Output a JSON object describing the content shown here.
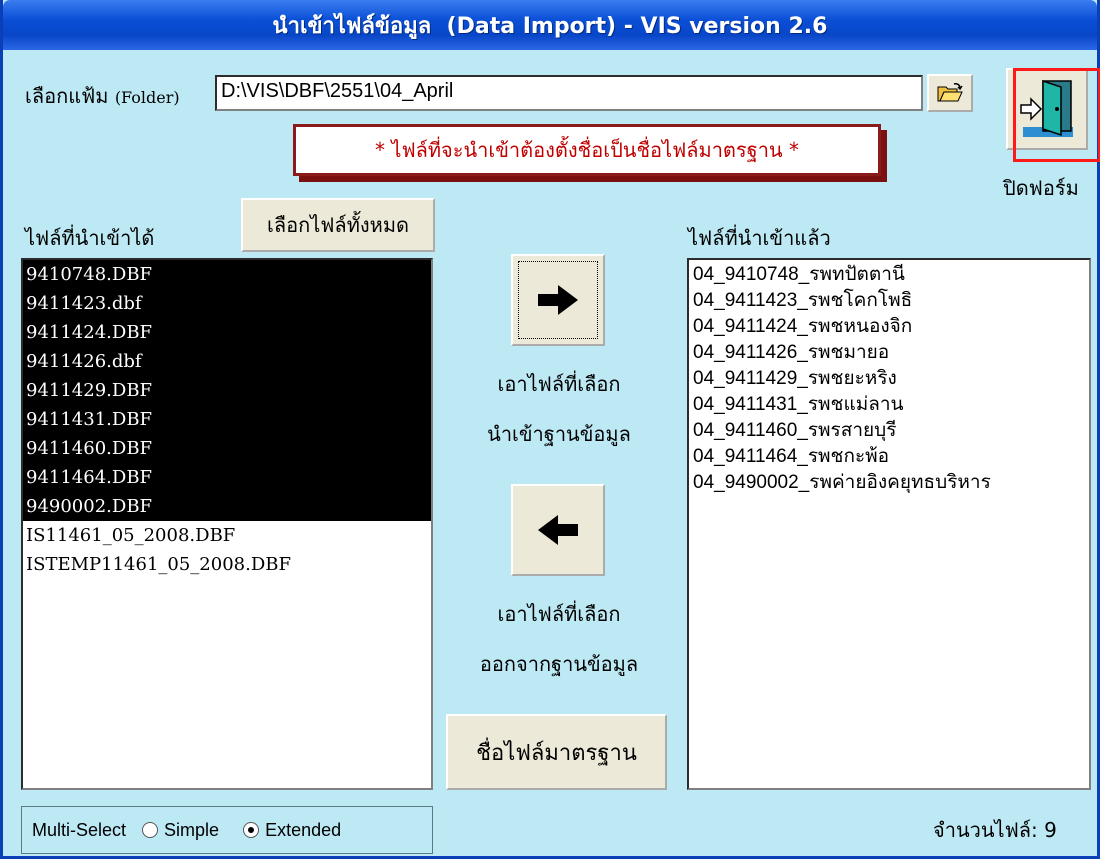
{
  "window": {
    "title": "นำเข้าไฟล์ข้อมูล  (Data Import) - VIS version 2.6"
  },
  "folder": {
    "label": "เลือกแฟ้ม",
    "label_paren": "(Folder)",
    "path": "D:\\VIS\\DBF\\2551\\04_April",
    "browse_icon": "open-folder-icon"
  },
  "close_form": {
    "label": "ปิดฟอร์ม",
    "icon": "exit-door-icon"
  },
  "notice": "* ไฟล์ที่จะนำเข้าต้องตั้งชื่อเป็นชื่อไฟล์มาตรฐาน *",
  "available": {
    "label": "ไฟล์ที่นำเข้าได้",
    "select_all_label": "เลือกไฟล์ทั้งหมด",
    "files": [
      {
        "name": "9410748.DBF",
        "selected": true
      },
      {
        "name": "9411423.dbf",
        "selected": true
      },
      {
        "name": "9411424.DBF",
        "selected": true
      },
      {
        "name": "9411426.dbf",
        "selected": true
      },
      {
        "name": "9411429.DBF",
        "selected": true
      },
      {
        "name": "9411431.DBF",
        "selected": true
      },
      {
        "name": "9411460.DBF",
        "selected": true
      },
      {
        "name": "9411464.DBF",
        "selected": true
      },
      {
        "name": "9490002.DBF",
        "selected": true
      },
      {
        "name": "IS11461_05_2008.DBF",
        "selected": false
      },
      {
        "name": "ISTEMP11461_05_2008.DBF",
        "selected": false
      }
    ]
  },
  "actions": {
    "add_line1": "เอาไฟล์ที่เลือก",
    "add_line2": "นำเข้าฐานข้อมูล",
    "remove_line1": "เอาไฟล์ที่เลือก",
    "remove_line2": "ออกจากฐานข้อมูล",
    "standard_names_label": "ชื่อไฟล์มาตรฐาน"
  },
  "imported": {
    "label": "ไฟล์ที่นำเข้าแล้ว",
    "files": [
      "04_9410748_รพทปัตตานี",
      "04_9411423_รพชโคกโพธิ",
      "04_9411424_รพชหนองจิก",
      "04_9411426_รพชมายอ",
      "04_9411429_รพชยะหริง",
      "04_9411431_รพชแม่ลาน",
      "04_9411460_รพรสายบุรี",
      "04_9411464_รพชกะพ้อ",
      "04_9490002_รพค่ายอิงคยุทธบริหาร"
    ]
  },
  "multi_select": {
    "label": "Multi-Select",
    "options": [
      "Simple",
      "Extended"
    ],
    "selected": "Extended"
  },
  "file_count": "จำนวนไฟล์: 9",
  "colors": {
    "background": "#bde9f5",
    "titlebar": "#0a4fd6",
    "notice_text": "#c00000",
    "highlight": "#ff1a1a"
  }
}
